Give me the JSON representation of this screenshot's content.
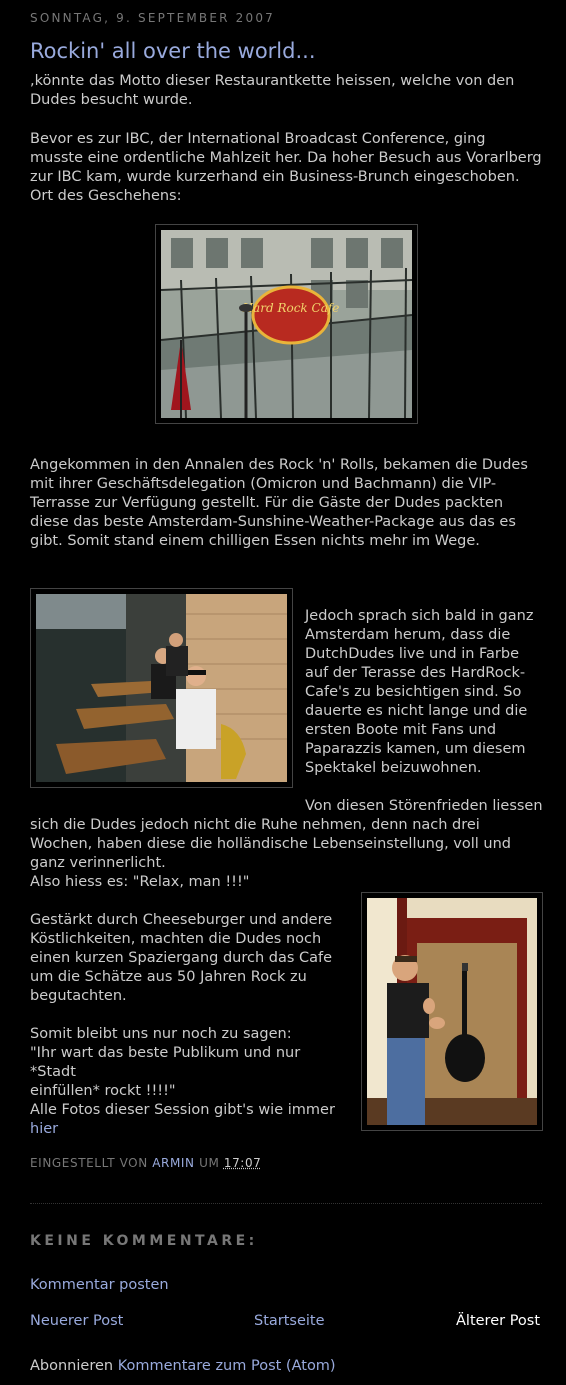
{
  "date_header": "Sonntag, 9. September 2007",
  "post": {
    "title": "Rockin' all over the world...",
    "p1": ",könnte das Motto dieser Restaurantkette heissen, welche von den\nDudes besucht wurde.",
    "p2": "Bevor es zur IBC, der International Broadcast Conference, ging\nmusste eine ordentliche Mahlzeit her. Da hoher Besuch aus Vorarlberg\nzur IBC kam, wurde kurzerhand ein Business-Brunch eingeschoben.\nOrt des Geschehens:",
    "p3": "Angekommen in den Annalen des Rock 'n' Rolls, bekamen die Dudes\nmit ihrer Geschäftsdelegation (Omicron und Bachmann) die VIP-\nTerrasse zur Verfügung gestellt. Für die Gäste der Dudes packten\ndiese das beste Amsterdam-Sunshine-Weather-Package aus das es\ngibt. Somit stand einem chilligen Essen nichts mehr im Wege.",
    "p4": "Jedoch sprach sich bald in ganz\nAmsterdam herum, dass die\nDutchDudes live und in Farbe\nauf der Terasse des HardRock-\nCafe's zu besichtigen sind. So\ndauerte es nicht lange und die\nersten Boote mit Fans und\nPaparazzis kamen, um diesem\nSpektakel beizuwohnen.",
    "p5_first": "Von diesen Störenfrieden liessen",
    "p5_rest": "sich die Dudes jedoch nicht die Ruhe nehmen, denn nach drei\nWochen, haben diese die holländische Lebenseinstellung, voll und\nganz verinnerlicht.\nAlso hiess es: \"Relax, man !!!\"",
    "p6": "Gestärkt durch Cheeseburger und andere\nKöstlichkeiten, machten die Dudes noch\neinen kurzen Spaziergang durch das Cafe\num die Schätze aus 50 Jahren Rock zu\nbegutachten.",
    "p7": "Somit bleibt uns nur noch zu sagen:\n\"Ihr wart das beste Publikum und nur *Stadt\neinfüllen* rockt !!!!\"",
    "p8": "Alle Fotos dieser Session gibt's wie immer",
    "p8_link": "hier",
    "sign_text": "Hard Rock Cafe"
  },
  "footer": {
    "posted_by": "Eingestellt von",
    "author": "Armin",
    "at": "um",
    "time": "17:07"
  },
  "comments": {
    "heading": "Keine Kommentare:",
    "post_comment": "Kommentar posten"
  },
  "nav": {
    "newer": "Neuerer Post",
    "home": "Startseite",
    "older": "Älterer Post"
  },
  "subscribe": {
    "label": "Abonnieren",
    "link": "Kommentare zum Post (Atom)"
  },
  "colors": {
    "background": "#000000",
    "link": "#99aadd",
    "text": "#cccccc",
    "muted": "#777777"
  }
}
